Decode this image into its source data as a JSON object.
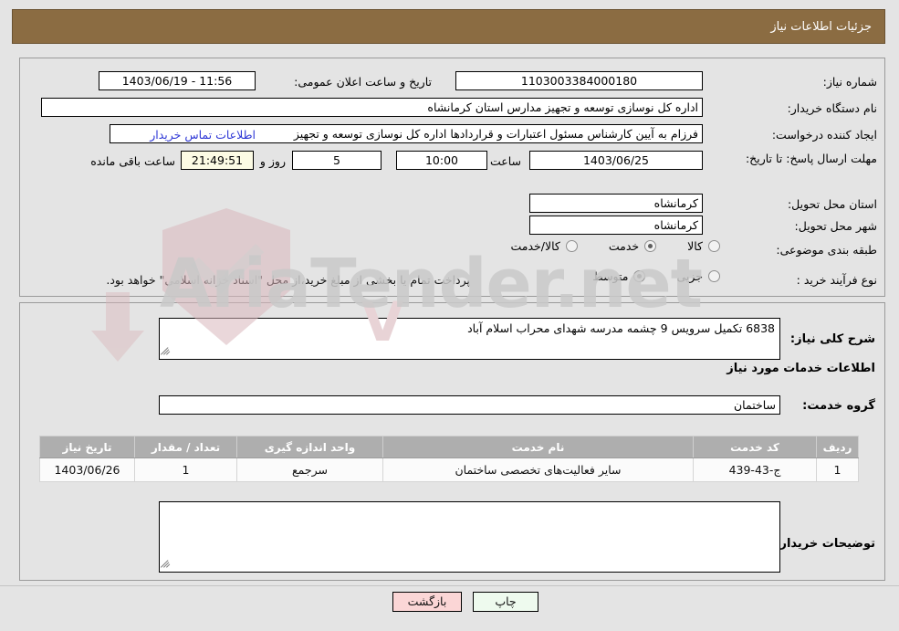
{
  "header": {
    "title": "جزئیات اطلاعات نیاز"
  },
  "form": {
    "need_number_label": "شماره نیاز:",
    "need_number_value": "1103003384000180",
    "public_announce_label": "تاریخ و ساعت اعلان عمومی:",
    "public_announce_value": "11:56 - 1403/06/19",
    "buyer_org_label": "نام دستگاه خریدار:",
    "buyer_org_value": "اداره کل نوسازی  توسعه و تجهیز مدارس استان کرمانشاه",
    "creator_label": "ایجاد کننده درخواست:",
    "creator_value": "فرزام به آیین کارشناس مسئول اعتبارات و قراردادها اداره کل نوسازی  توسعه و تجهیز",
    "buyer_contact_link": "اطلاعات تماس خریدار",
    "deadline_label": "مهلت ارسال پاسخ: تا تاریخ:",
    "deadline_date": "1403/06/25",
    "time_label": "ساعت",
    "time_value": "10:00",
    "days_value": "5",
    "days_label": "روز و",
    "countdown_value": "21:49:51",
    "countdown_label": "ساعت باقی مانده",
    "province_label": "استان محل تحویل:",
    "province_value": "کرمانشاه",
    "city_label": "شهر محل تحویل:",
    "city_value": "کرمانشاه",
    "category_label": "طبقه بندی موضوعی:",
    "category_options": [
      {
        "label": "کالا",
        "selected": false
      },
      {
        "label": "خدمت",
        "selected": true
      },
      {
        "label": "کالا/خدمت",
        "selected": false
      }
    ],
    "process_label": "نوع فرآیند خرید :",
    "process_options": [
      {
        "label": "جزیی",
        "selected": false
      },
      {
        "label": "متوسط",
        "selected": true
      }
    ],
    "process_note": "پرداخت تمام یا بخشی از مبلغ خرید،از محل \"اسناد خزانه اسلامی\" خواهد بود."
  },
  "description": {
    "label": "شرح کلی نیاز:",
    "value": "6838 تکمیل سرویس 9 چشمه مدرسه شهدای محراب اسلام آباد"
  },
  "services": {
    "section_title": "اطلاعات خدمات مورد نیاز",
    "group_label": "گروه خدمت:",
    "group_value": "ساختمان",
    "columns": [
      "ردیف",
      "کد خدمت",
      "نام خدمت",
      "واحد اندازه گیری",
      "تعداد / مقدار",
      "تاریخ نیاز"
    ],
    "rows": [
      {
        "row_no": "1",
        "service_code": "ج-43-439",
        "service_name": "سایر فعالیت‌های تخصصی ساختمان",
        "unit": "سرجمع",
        "quantity": "1",
        "need_date": "1403/06/26"
      }
    ]
  },
  "buyer_notes": {
    "label": "توضیحات خریدار:",
    "value": ""
  },
  "footer": {
    "print_label": "چاپ",
    "back_label": "بازگشت"
  },
  "watermark": {
    "text": "AriaTender.net"
  },
  "colors": {
    "header_bg": "#8b6c42",
    "page_bg": "#e4e4e4",
    "link": "#2f38d6",
    "table_header_bg": "#aeaeae",
    "print_button_bg": "#eefaee",
    "back_button_bg": "#fbd6d6",
    "countdown_bg": "#fcfbe4"
  }
}
